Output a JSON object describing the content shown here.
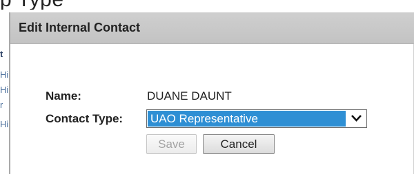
{
  "top_strip": {
    "text": "p                                              Type"
  },
  "background_page": {
    "fragments": [
      "t",
      "Hi",
      "Hi",
      "r",
      "Hi"
    ]
  },
  "dialog": {
    "title": "Edit Internal Contact",
    "name_label": "Name:",
    "name_value": "DUANE DAUNT",
    "contact_type_label": "Contact Type:",
    "contact_type_select": {
      "selected": "UAO Representative",
      "arrow_icon": "chevron-down-icon"
    },
    "buttons": {
      "save": {
        "label": "Save",
        "disabled": true
      },
      "cancel": {
        "label": "Cancel",
        "disabled": false
      }
    }
  },
  "colors": {
    "header_bg": "#c8c8c8",
    "selection_bg": "#2e8fd4",
    "selection_text": "#ffffff",
    "background_link": "#4a6f9c"
  }
}
